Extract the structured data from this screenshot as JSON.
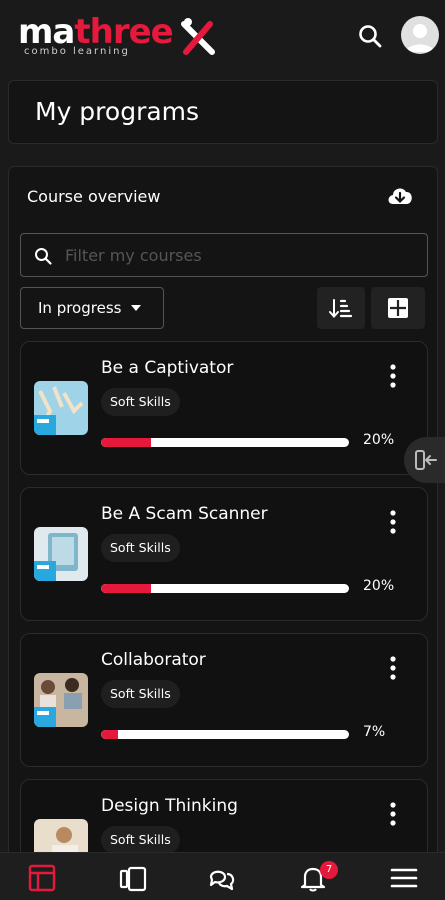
{
  "brand": {
    "logo_main_a": "ma",
    "logo_main_b": "three",
    "logo_sub": "combo learning",
    "accent": "#e5193c"
  },
  "header": {
    "search_icon": "search-icon",
    "avatar_icon": "user-avatar"
  },
  "page": {
    "title": "My programs"
  },
  "overview": {
    "title": "Course overview",
    "download_icon": "cloud-download-icon",
    "filter_placeholder": "Filter my courses",
    "status_selected": "In progress"
  },
  "courses": [
    {
      "name": "Be a Captivator",
      "tag": "Soft Skills",
      "progress": 20,
      "progress_label": "20%"
    },
    {
      "name": "Be A Scam Scanner",
      "tag": "Soft Skills",
      "progress": 20,
      "progress_label": "20%"
    },
    {
      "name": "Collaborator",
      "tag": "Soft Skills",
      "progress": 7,
      "progress_label": "7%"
    },
    {
      "name": "Design Thinking",
      "tag": "Soft Skills",
      "progress": 0,
      "progress_label": ""
    }
  ],
  "bottom_nav": {
    "items": [
      "dashboard-icon",
      "courses-icon",
      "messages-icon",
      "notifications-icon",
      "menu-icon"
    ],
    "notification_count": "7"
  }
}
